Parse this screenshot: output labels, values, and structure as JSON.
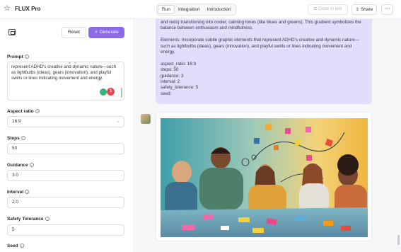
{
  "header": {
    "title": "FLUX Pro",
    "tabs": [
      {
        "label": "Run",
        "active": true
      },
      {
        "label": "Integration",
        "active": false
      },
      {
        "label": "Introduction",
        "active": false
      }
    ],
    "clone_label": "Clone to edit",
    "share_label": "Share",
    "more_label": "···"
  },
  "controls": {
    "reset_label": "Reset",
    "generate_label": "Generate"
  },
  "form": {
    "prompt_label": "Prompt",
    "prompt_text": "Elements: Incorporate subtle graphic elements that represent ADHD's creative and dynamic nature—such as lightbulbs (ideas), gears (innovation), and playful swirls or lines indicating movement and energy.",
    "notification_count": "1",
    "aspect_ratio_label": "Aspect ratio",
    "aspect_ratio_value": "16:9",
    "steps_label": "Steps",
    "steps_value": "50",
    "guidance_label": "Guidance",
    "guidance_value": "3.0",
    "interval_label": "Interval",
    "interval_value": "2.0",
    "safety_label": "Safety Tolerance",
    "safety_value": "5",
    "seed_label": "Seed"
  },
  "chat": {
    "user_message_lines": [
      "and reds) transitioning into cooler, calming tones (like blues and greens). This gradient symbolizes the balance between enthusiasm and mindfulness.",
      "Elements: Incorporate subtle graphic elements that represent ADHD's creative and dynamic nature—such as lightbulbs (ideas), gears (innovation), and playful swirls or lines indicating movement and energy."
    ],
    "params": [
      "aspect_ratio: 16:9",
      "steps: 50",
      "guidance: 3",
      "interval: 2",
      "safety_tolerance: 5",
      "seed:"
    ]
  },
  "colors": {
    "accent": "#8b6be8",
    "user_bubble": "#e4dcfb",
    "badge_red": "#e5484d",
    "badge_green": "#36b37e"
  }
}
